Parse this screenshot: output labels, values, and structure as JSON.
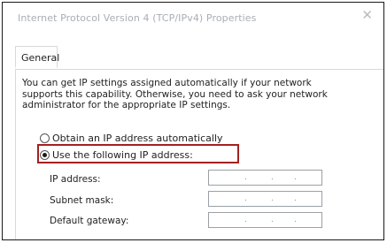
{
  "window": {
    "title": "Internet Protocol Version 4 (TCP/IPv4) Properties",
    "close_glyph": "✕"
  },
  "tabs": [
    {
      "label": "General",
      "selected": true
    }
  ],
  "general": {
    "description": "You can get IP settings assigned automatically if your network supports this capability. Otherwise, you need to ask your network administrator for the appropriate IP settings.",
    "radio_auto": {
      "label": "Obtain an IP address automatically",
      "selected": false
    },
    "radio_manual": {
      "label": "Use the following IP address:",
      "selected": true
    },
    "fields": [
      {
        "label": "IP address:",
        "value": ""
      },
      {
        "label": "Subnet mask:",
        "value": ""
      },
      {
        "label": "Default gateway:",
        "value": ""
      }
    ]
  },
  "colors": {
    "highlight_border": "#a52020"
  }
}
